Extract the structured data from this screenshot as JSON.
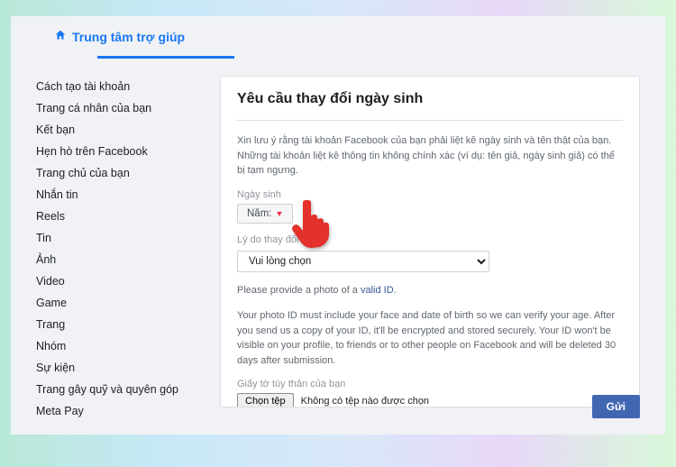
{
  "header": {
    "help_center": "Trung tâm trợ giúp"
  },
  "sidebar": {
    "items": [
      "Cách tạo tài khoản",
      "Trang cá nhân của bạn",
      "Kết bạn",
      "Hẹn hò trên Facebook",
      "Trang chủ của bạn",
      "Nhắn tin",
      "Reels",
      "Tin",
      "Ảnh",
      "Video",
      "Game",
      "Trang",
      "Nhóm",
      "Sự kiện",
      "Trang gây quỹ và quyên góp",
      "Meta Pay"
    ]
  },
  "main": {
    "title": "Yêu cầu thay đổi ngày sinh",
    "notice": "Xin lưu ý rằng tài khoản Facebook của bạn phải liệt kê ngày sinh và tên thật của bạn. Những tài khoản liệt kê thông tin không chính xác (ví dụ: tên giả, ngày sinh giả) có thể bị tạm ngưng.",
    "birthday_label": "Ngày sinh",
    "year_label": "Năm:",
    "reason_label": "Lý do thay đổi này",
    "reason_placeholder": "Vui lòng chọn",
    "photo_prompt_pre": "Please provide a photo of a ",
    "photo_prompt_link": "valid ID",
    "photo_info": "Your photo ID must include your face and date of birth so we can verify your age. After you send us a copy of your ID, it'll be encrypted and stored securely. Your ID won't be visible on your profile, to friends or to other people on Facebook and will be deleted 30 days after submission.",
    "id_label": "Giấy tờ tùy thân của bạn",
    "file_button": "Chọn tệp",
    "file_status": "Không có tệp nào được chọn",
    "submit": "Gửi"
  }
}
